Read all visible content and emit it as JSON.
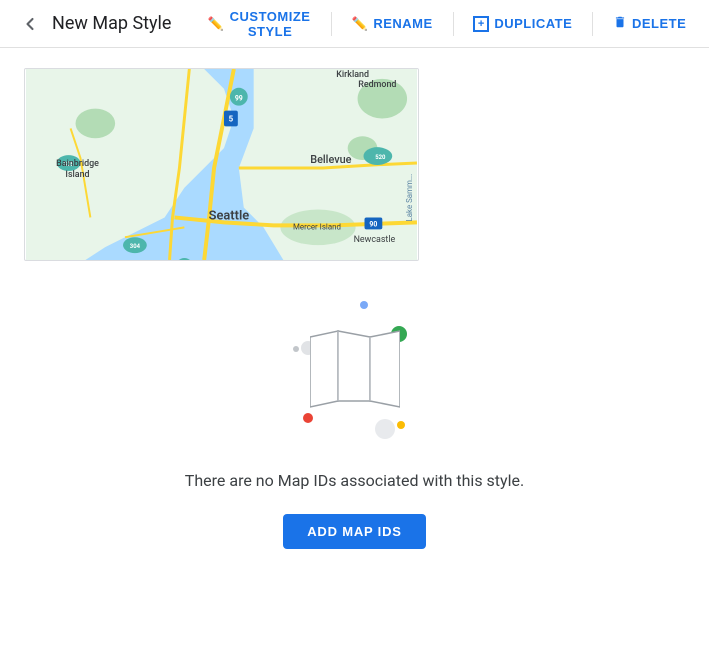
{
  "header": {
    "back_icon": "←",
    "title": "New Map Style",
    "actions": [
      {
        "id": "customize",
        "label": "CUSTOMIZE STYLE",
        "icon": "✏"
      },
      {
        "id": "rename",
        "label": "RENAME",
        "icon": "✏"
      },
      {
        "id": "duplicate",
        "label": "DUPLICATE",
        "icon": "+"
      },
      {
        "id": "delete",
        "label": "DELETE",
        "icon": "🗑"
      }
    ]
  },
  "empty_state": {
    "message": "There are no Map IDs associated with this style.",
    "add_button_label": "ADD MAP IDS"
  },
  "colors": {
    "accent": "#1a73e8",
    "dot_blue": "#4285f4",
    "dot_green": "#34a853",
    "dot_red": "#ea4335",
    "dot_yellow": "#fbbc04"
  }
}
